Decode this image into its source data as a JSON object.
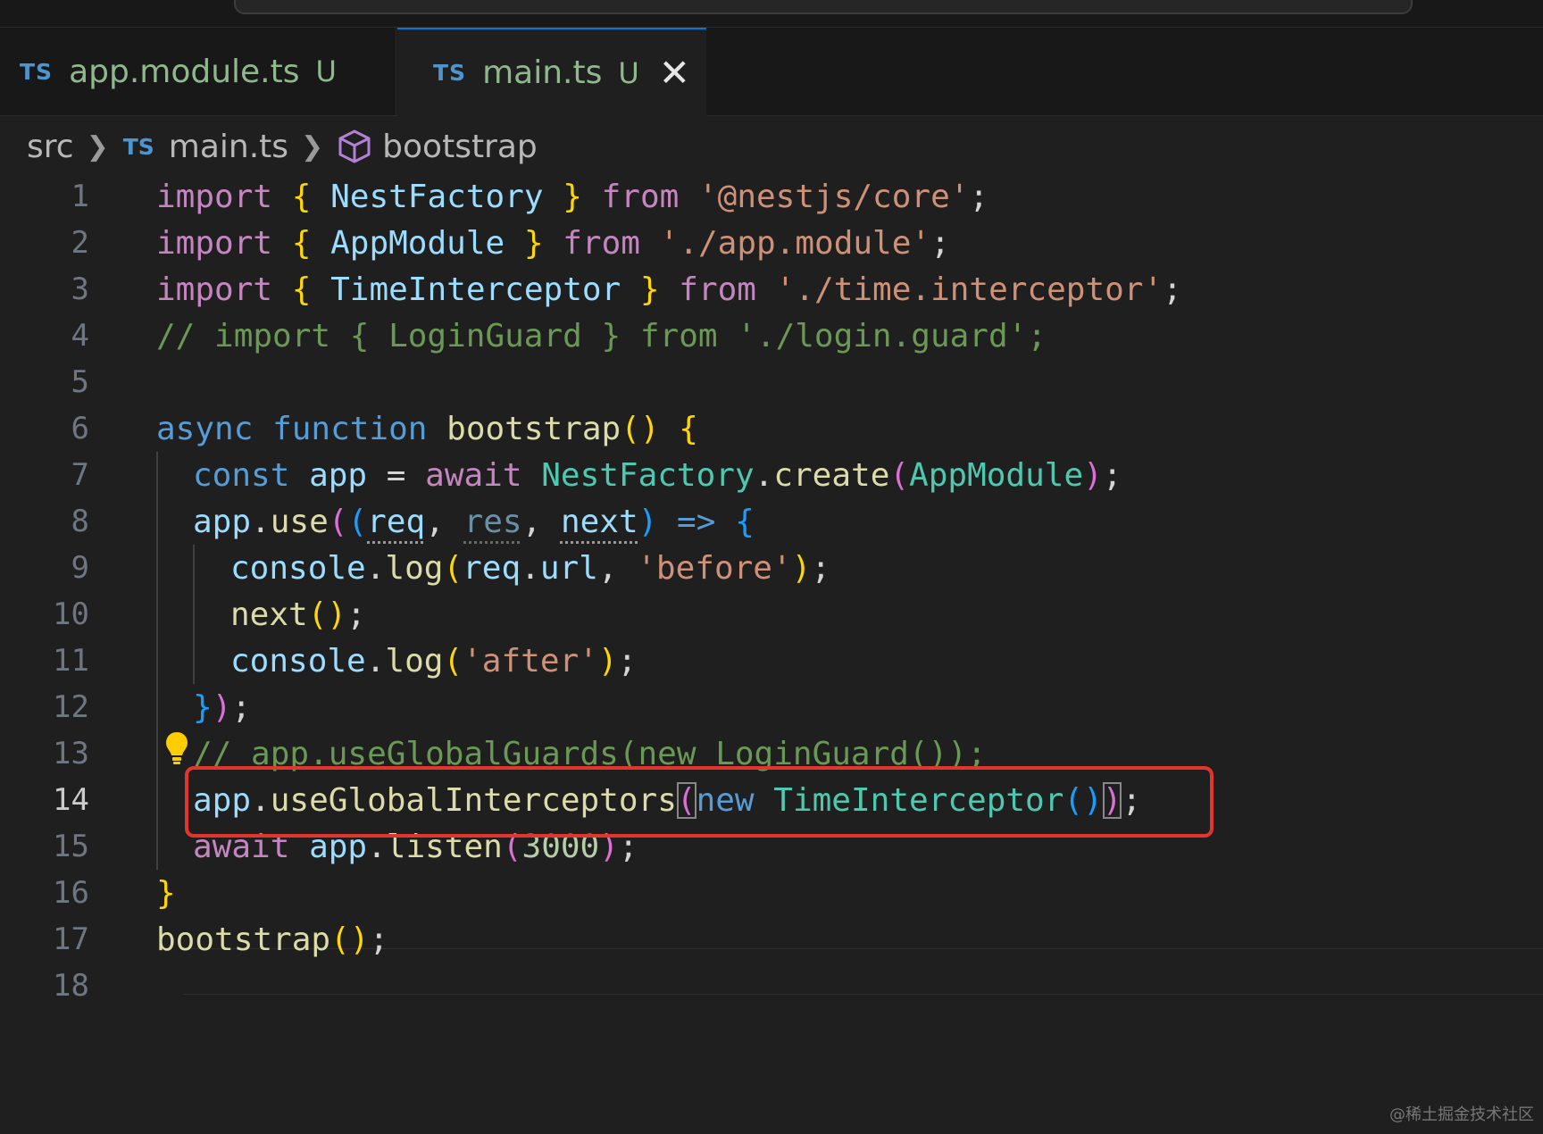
{
  "tabs": [
    {
      "badge": "TS",
      "name": "app.module.ts",
      "status": "U"
    },
    {
      "badge": "TS",
      "name": "main.ts",
      "status": "U",
      "close": "✕"
    }
  ],
  "breadcrumb": {
    "folder": "src",
    "badge": "TS",
    "file": "main.ts",
    "symbol": "bootstrap"
  },
  "line_numbers": [
    "1",
    "2",
    "3",
    "4",
    "5",
    "6",
    "7",
    "8",
    "9",
    "10",
    "11",
    "12",
    "13",
    "14",
    "15",
    "16",
    "17",
    "18"
  ],
  "code": {
    "l1": [
      "import",
      "{",
      "NestFactory",
      "}",
      "from",
      "'@nestjs/core'",
      ";"
    ],
    "l2": [
      "import",
      "{",
      "AppModule",
      "}",
      "from",
      "'./app.module'",
      ";"
    ],
    "l3": [
      "import",
      "{",
      "TimeInterceptor",
      "}",
      "from",
      "'./time.interceptor'",
      ";"
    ],
    "l4": "// import { LoginGuard } from './login.guard';",
    "l6": [
      "async",
      "function",
      "bootstrap",
      "()",
      "{"
    ],
    "l7": [
      "const",
      "app",
      "=",
      "await",
      "NestFactory",
      ".",
      "create",
      "(",
      "AppModule",
      ")",
      ";"
    ],
    "l8": [
      "app",
      ".",
      "use",
      "(",
      "(",
      "req",
      ",",
      "res",
      ",",
      "next",
      ")",
      "=>",
      "{"
    ],
    "l9": [
      "console",
      ".",
      "log",
      "(",
      "req",
      ".",
      "url",
      ",",
      "'before'",
      ")",
      ";"
    ],
    "l10": [
      "next",
      "()",
      ";"
    ],
    "l11": [
      "console",
      ".",
      "log",
      "(",
      "'after'",
      ")",
      ";"
    ],
    "l12": [
      "}",
      ")",
      ";"
    ],
    "l13": "// app.useGlobalGuards(new LoginGuard());",
    "l14": [
      "app",
      ".",
      "useGlobalInterceptors",
      "(",
      "new",
      "TimeInterceptor",
      "()",
      ")",
      ";"
    ],
    "l15": [
      "await",
      "app",
      ".",
      "listen",
      "(",
      "3000",
      ")",
      ";"
    ],
    "l16": "}",
    "l17": [
      "bootstrap",
      "()",
      ";"
    ]
  },
  "watermark": "@稀土掘金技术社区",
  "colors": {
    "highlight": "#e2362c",
    "accent": "#0078d4"
  }
}
